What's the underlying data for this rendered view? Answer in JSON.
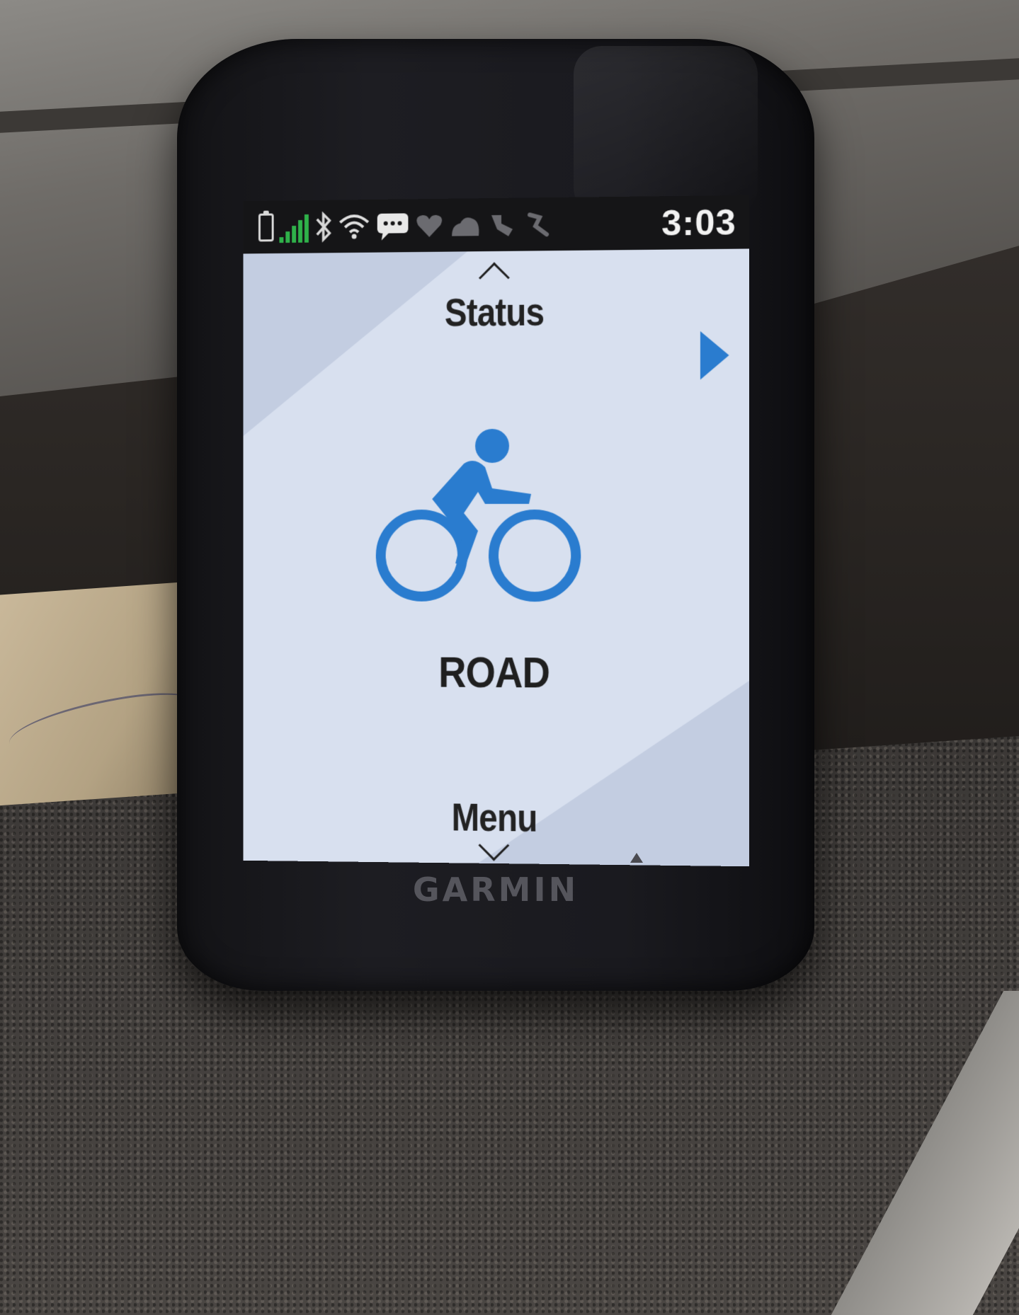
{
  "status_bar": {
    "time": "3:03",
    "icons": [
      "battery-icon",
      "signal-icon",
      "bluetooth-icon",
      "wifi-icon",
      "message-icon",
      "heart-icon",
      "weather-icon",
      "sensor-icon",
      "power-meter-icon"
    ],
    "signal_color": "#2fb24a"
  },
  "screen": {
    "up_label": "Status",
    "down_label": "Menu",
    "activity_profile": "ROAD",
    "accent_color": "#2a7ccf"
  },
  "device": {
    "brand": "GARMIN"
  }
}
